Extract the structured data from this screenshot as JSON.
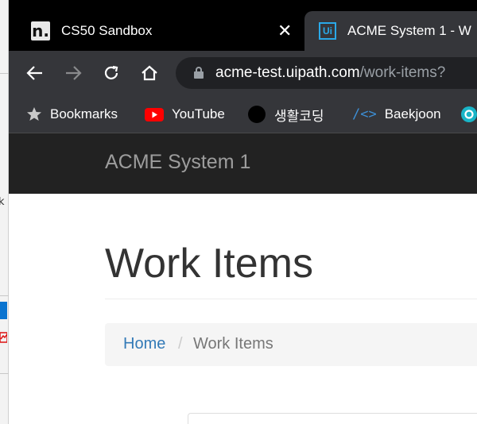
{
  "tabs": [
    {
      "title": "CS50 Sandbox",
      "favicon": "cs50-n-icon",
      "active": false
    },
    {
      "title": "ACME System 1 - W",
      "favicon": "uipath-ui-icon",
      "active": true
    }
  ],
  "toolbar": {
    "url_host": "acme-test.uipath.com",
    "url_path": "/work-items?"
  },
  "bookmarks": [
    {
      "label": "Bookmarks",
      "icon": "star-icon"
    },
    {
      "label": "YouTube",
      "icon": "youtube-icon"
    },
    {
      "label": "생활코딩",
      "icon": "black-circle-icon"
    },
    {
      "label": "Baekjoon",
      "icon": "code-brackets-icon"
    }
  ],
  "app": {
    "brand": "ACME System 1",
    "page_title": "Work Items",
    "breadcrumb": {
      "home": "Home",
      "separator": "/",
      "current": "Work Items"
    }
  },
  "colors": {
    "tab_bar": "#000000",
    "toolbar": "#35363a",
    "navbar": "#222222",
    "link": "#337ab7"
  },
  "left_window_fragment": {
    "text": "k"
  }
}
